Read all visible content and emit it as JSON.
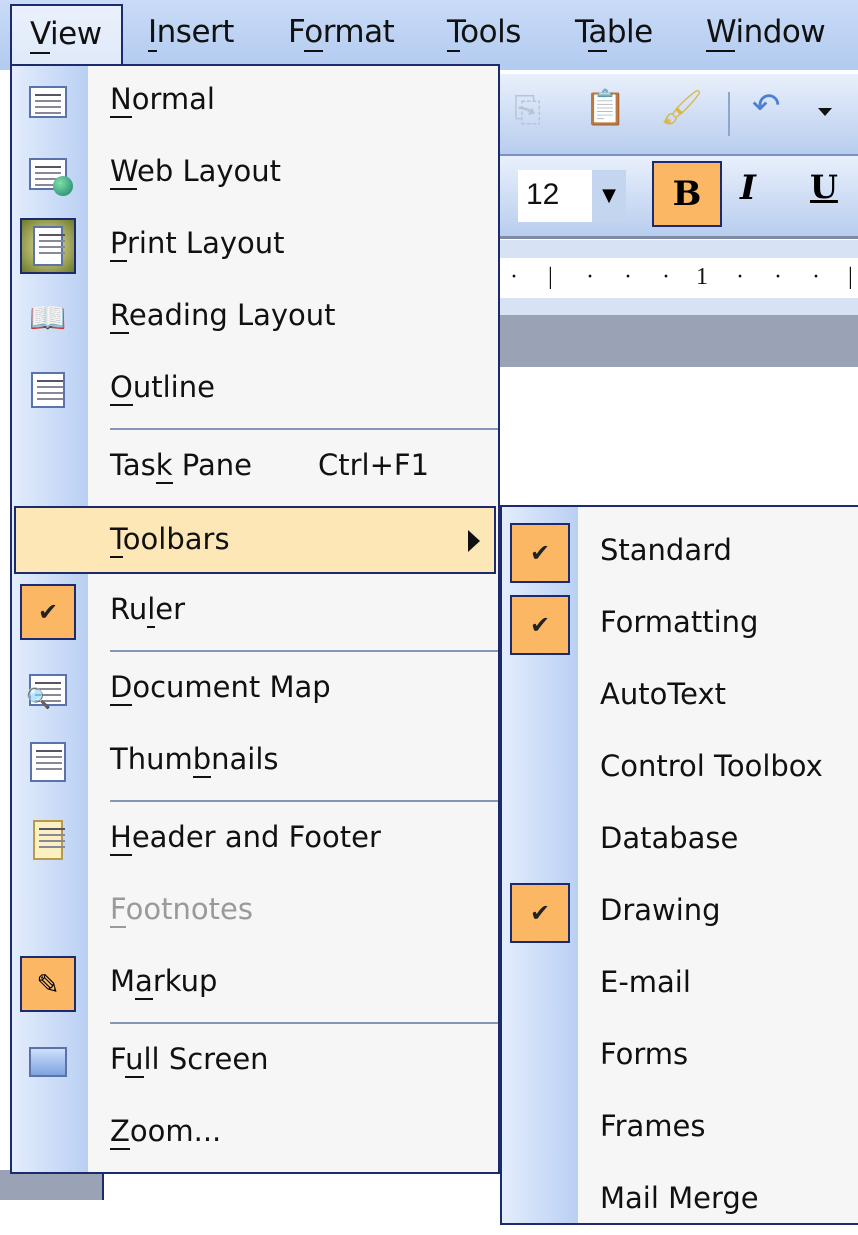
{
  "menubar": {
    "items": [
      {
        "label": "View",
        "accel": "V",
        "active": true
      },
      {
        "label": "Insert",
        "accel": "I"
      },
      {
        "label": "Format",
        "accel": "o"
      },
      {
        "label": "Tools",
        "accel": "T"
      },
      {
        "label": "Table",
        "accel": "a"
      },
      {
        "label": "Window",
        "accel": "W"
      }
    ]
  },
  "toolbar": {
    "standard": {
      "icons": [
        "copy-icon",
        "paste-icon",
        "format-painter-icon",
        "undo-icon",
        "undo-dropdown-icon"
      ]
    },
    "formatting": {
      "font_size": "12",
      "bold_label": "B",
      "italic_label": "I",
      "underline_label": "U",
      "bold_active": true
    },
    "ruler": {
      "mark_label": "1"
    }
  },
  "view_menu": {
    "items": [
      {
        "label": "Normal",
        "accel": "N",
        "icon": "normal-view-icon"
      },
      {
        "label": "Web Layout",
        "accel": "W",
        "icon": "web-layout-icon"
      },
      {
        "label": "Print Layout",
        "accel": "P",
        "icon": "print-layout-icon",
        "pressed": true
      },
      {
        "label": "Reading Layout",
        "accel": "R",
        "icon": "reading-layout-icon"
      },
      {
        "label": "Outline",
        "accel": "O",
        "icon": "outline-icon"
      },
      {
        "label": "Task Pane",
        "accel": "k",
        "shortcut": "Ctrl+F1"
      },
      {
        "label": "Toolbars",
        "accel": "T",
        "submenu": true,
        "highlighted": true
      },
      {
        "label": "Ruler",
        "accel": "l",
        "checked": true
      },
      {
        "label": "Document Map",
        "accel": "D",
        "icon": "document-map-icon"
      },
      {
        "label": "Thumbnails",
        "accel": "b",
        "icon": "thumbnails-icon"
      },
      {
        "label": "Header and Footer",
        "accel": "H",
        "icon": "header-footer-icon"
      },
      {
        "label": "Footnotes",
        "accel": "F",
        "disabled": true
      },
      {
        "label": "Markup",
        "accel": "a",
        "icon": "markup-icon",
        "pressed": true
      },
      {
        "label": "Full Screen",
        "accel": "u",
        "icon": "full-screen-icon"
      },
      {
        "label": "Zoom...",
        "accel": "Z"
      }
    ]
  },
  "toolbars_submenu": {
    "items": [
      {
        "label": "Standard",
        "checked": true
      },
      {
        "label": "Formatting",
        "checked": true
      },
      {
        "label": "AutoText",
        "checked": false
      },
      {
        "label": "Control Toolbox",
        "checked": false
      },
      {
        "label": "Database",
        "checked": false
      },
      {
        "label": "Drawing",
        "checked": true
      },
      {
        "label": "E-mail",
        "checked": false
      },
      {
        "label": "Forms",
        "checked": false
      },
      {
        "label": "Frames",
        "checked": false
      },
      {
        "label": "Mail Merge",
        "checked": false
      }
    ]
  },
  "colors": {
    "menu_border": "#1b2b6e",
    "highlight": "#fde7b6",
    "checked_bg": "#fbb763",
    "menu_bg": "#f6f6f6",
    "gutter": "#b9cff3"
  }
}
